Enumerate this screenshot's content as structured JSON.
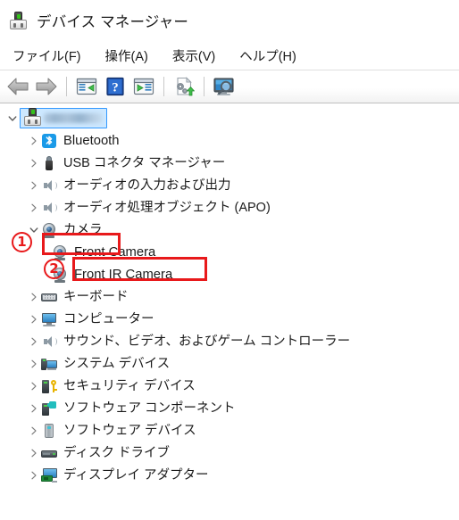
{
  "window": {
    "title": "デバイス マネージャー",
    "icon": "device-manager-icon"
  },
  "menubar": {
    "items": [
      {
        "label": "ファイル(F)",
        "name": "menu-file"
      },
      {
        "label": "操作(A)",
        "name": "menu-action"
      },
      {
        "label": "表示(V)",
        "name": "menu-view"
      },
      {
        "label": "ヘルプ(H)",
        "name": "menu-help"
      }
    ]
  },
  "toolbar": {
    "buttons": [
      {
        "name": "back-button",
        "icon": "back-arrow-icon",
        "tooltip": "戻る"
      },
      {
        "name": "forward-button",
        "icon": "forward-arrow-icon",
        "tooltip": "進む"
      },
      {
        "name": "show-hide-tree-button",
        "icon": "console-tree-icon",
        "tooltip": "コンソール ツリーの表示/非表示"
      },
      {
        "name": "help-button",
        "icon": "question-mark-icon",
        "tooltip": "ヘルプ"
      },
      {
        "name": "properties-button",
        "icon": "properties-panel-icon",
        "tooltip": "プロパティ"
      },
      {
        "name": "update-driver-button",
        "icon": "update-driver-icon",
        "tooltip": "ドライバーの更新"
      },
      {
        "name": "scan-hardware-button",
        "icon": "scan-hardware-icon",
        "tooltip": "ハードウェア変更のスキャン"
      }
    ]
  },
  "tree": {
    "root": {
      "name": "computer-root-node",
      "label": "",
      "redacted": true,
      "expanded": true,
      "selected": true,
      "icon": "computer-icon"
    },
    "items": [
      {
        "label": "Bluetooth",
        "icon": "bluetooth-icon",
        "level": 1,
        "expandable": true,
        "expanded": false,
        "script": "en"
      },
      {
        "label": "USB コネクタ マネージャー",
        "icon": "usb-connector-icon",
        "level": 1,
        "expandable": true,
        "expanded": false,
        "script": "ja"
      },
      {
        "label": "オーディオの入力および出力",
        "icon": "speaker-icon",
        "level": 1,
        "expandable": true,
        "expanded": false,
        "script": "ja"
      },
      {
        "label": "オーディオ処理オブジェクト (APO)",
        "icon": "speaker-icon",
        "level": 1,
        "expandable": true,
        "expanded": false,
        "script": "ja"
      },
      {
        "label": "カメラ",
        "icon": "camera-icon",
        "level": 1,
        "expandable": true,
        "expanded": true,
        "script": "ja",
        "annotated": 1
      },
      {
        "label": "Front Camera",
        "icon": "camera-icon",
        "level": 2,
        "expandable": false,
        "expanded": false,
        "script": "en",
        "annotated": 2
      },
      {
        "label": "Front IR Camera",
        "icon": "camera-icon",
        "level": 2,
        "expandable": false,
        "expanded": false,
        "script": "en"
      },
      {
        "label": "キーボード",
        "icon": "keyboard-icon",
        "level": 1,
        "expandable": true,
        "expanded": false,
        "script": "ja"
      },
      {
        "label": "コンピューター",
        "icon": "monitor-icon",
        "level": 1,
        "expandable": true,
        "expanded": false,
        "script": "ja"
      },
      {
        "label": "サウンド、ビデオ、およびゲーム コントローラー",
        "icon": "speaker-icon",
        "level": 1,
        "expandable": true,
        "expanded": false,
        "script": "ja"
      },
      {
        "label": "システム デバイス",
        "icon": "system-device-icon",
        "level": 1,
        "expandable": true,
        "expanded": false,
        "script": "ja"
      },
      {
        "label": "セキュリティ デバイス",
        "icon": "security-device-icon",
        "level": 1,
        "expandable": true,
        "expanded": false,
        "script": "ja"
      },
      {
        "label": "ソフトウェア コンポーネント",
        "icon": "software-component-icon",
        "level": 1,
        "expandable": true,
        "expanded": false,
        "script": "ja"
      },
      {
        "label": "ソフトウェア デバイス",
        "icon": "software-device-icon",
        "level": 1,
        "expandable": true,
        "expanded": false,
        "script": "ja"
      },
      {
        "label": "ディスク ドライブ",
        "icon": "disk-drive-icon",
        "level": 1,
        "expandable": true,
        "expanded": false,
        "script": "ja"
      },
      {
        "label": "ディスプレイ アダプター",
        "icon": "display-adapter-icon",
        "level": 1,
        "expandable": true,
        "expanded": false,
        "script": "ja"
      }
    ]
  },
  "annotations": {
    "color": "#e8191b",
    "markers": [
      {
        "number": "①",
        "digit": "1",
        "name": "annotation-marker-1",
        "target": "カメラ"
      },
      {
        "number": "②",
        "digit": "2",
        "name": "annotation-marker-2",
        "target": "Front Camera"
      }
    ]
  }
}
